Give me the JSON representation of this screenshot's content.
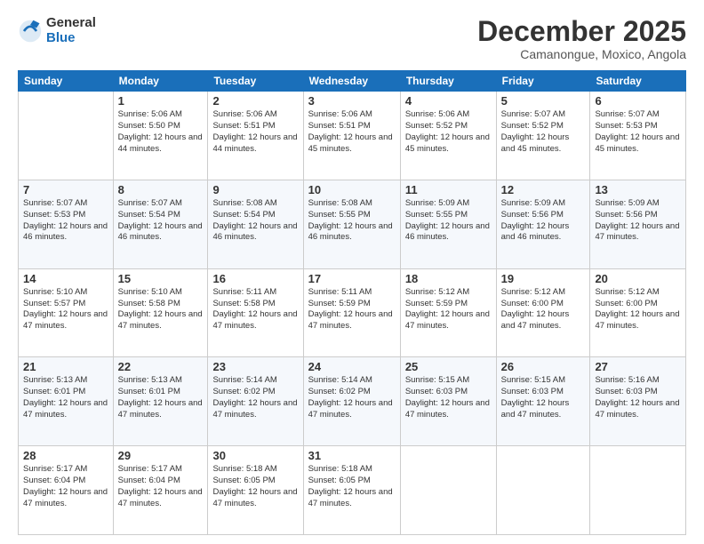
{
  "logo": {
    "general": "General",
    "blue": "Blue"
  },
  "title": {
    "month_year": "December 2025",
    "location": "Camanongue, Moxico, Angola"
  },
  "days_of_week": [
    "Sunday",
    "Monday",
    "Tuesday",
    "Wednesday",
    "Thursday",
    "Friday",
    "Saturday"
  ],
  "weeks": [
    [
      {
        "day": "",
        "info": ""
      },
      {
        "day": "1",
        "info": "Sunrise: 5:06 AM\nSunset: 5:50 PM\nDaylight: 12 hours\nand 44 minutes."
      },
      {
        "day": "2",
        "info": "Sunrise: 5:06 AM\nSunset: 5:51 PM\nDaylight: 12 hours\nand 44 minutes."
      },
      {
        "day": "3",
        "info": "Sunrise: 5:06 AM\nSunset: 5:51 PM\nDaylight: 12 hours\nand 45 minutes."
      },
      {
        "day": "4",
        "info": "Sunrise: 5:06 AM\nSunset: 5:52 PM\nDaylight: 12 hours\nand 45 minutes."
      },
      {
        "day": "5",
        "info": "Sunrise: 5:07 AM\nSunset: 5:52 PM\nDaylight: 12 hours\nand 45 minutes."
      },
      {
        "day": "6",
        "info": "Sunrise: 5:07 AM\nSunset: 5:53 PM\nDaylight: 12 hours\nand 45 minutes."
      }
    ],
    [
      {
        "day": "7",
        "info": "Sunrise: 5:07 AM\nSunset: 5:53 PM\nDaylight: 12 hours\nand 46 minutes."
      },
      {
        "day": "8",
        "info": "Sunrise: 5:07 AM\nSunset: 5:54 PM\nDaylight: 12 hours\nand 46 minutes."
      },
      {
        "day": "9",
        "info": "Sunrise: 5:08 AM\nSunset: 5:54 PM\nDaylight: 12 hours\nand 46 minutes."
      },
      {
        "day": "10",
        "info": "Sunrise: 5:08 AM\nSunset: 5:55 PM\nDaylight: 12 hours\nand 46 minutes."
      },
      {
        "day": "11",
        "info": "Sunrise: 5:09 AM\nSunset: 5:55 PM\nDaylight: 12 hours\nand 46 minutes."
      },
      {
        "day": "12",
        "info": "Sunrise: 5:09 AM\nSunset: 5:56 PM\nDaylight: 12 hours\nand 46 minutes."
      },
      {
        "day": "13",
        "info": "Sunrise: 5:09 AM\nSunset: 5:56 PM\nDaylight: 12 hours\nand 47 minutes."
      }
    ],
    [
      {
        "day": "14",
        "info": "Sunrise: 5:10 AM\nSunset: 5:57 PM\nDaylight: 12 hours\nand 47 minutes."
      },
      {
        "day": "15",
        "info": "Sunrise: 5:10 AM\nSunset: 5:58 PM\nDaylight: 12 hours\nand 47 minutes."
      },
      {
        "day": "16",
        "info": "Sunrise: 5:11 AM\nSunset: 5:58 PM\nDaylight: 12 hours\nand 47 minutes."
      },
      {
        "day": "17",
        "info": "Sunrise: 5:11 AM\nSunset: 5:59 PM\nDaylight: 12 hours\nand 47 minutes."
      },
      {
        "day": "18",
        "info": "Sunrise: 5:12 AM\nSunset: 5:59 PM\nDaylight: 12 hours\nand 47 minutes."
      },
      {
        "day": "19",
        "info": "Sunrise: 5:12 AM\nSunset: 6:00 PM\nDaylight: 12 hours\nand 47 minutes."
      },
      {
        "day": "20",
        "info": "Sunrise: 5:12 AM\nSunset: 6:00 PM\nDaylight: 12 hours\nand 47 minutes."
      }
    ],
    [
      {
        "day": "21",
        "info": "Sunrise: 5:13 AM\nSunset: 6:01 PM\nDaylight: 12 hours\nand 47 minutes."
      },
      {
        "day": "22",
        "info": "Sunrise: 5:13 AM\nSunset: 6:01 PM\nDaylight: 12 hours\nand 47 minutes."
      },
      {
        "day": "23",
        "info": "Sunrise: 5:14 AM\nSunset: 6:02 PM\nDaylight: 12 hours\nand 47 minutes."
      },
      {
        "day": "24",
        "info": "Sunrise: 5:14 AM\nSunset: 6:02 PM\nDaylight: 12 hours\nand 47 minutes."
      },
      {
        "day": "25",
        "info": "Sunrise: 5:15 AM\nSunset: 6:03 PM\nDaylight: 12 hours\nand 47 minutes."
      },
      {
        "day": "26",
        "info": "Sunrise: 5:15 AM\nSunset: 6:03 PM\nDaylight: 12 hours\nand 47 minutes."
      },
      {
        "day": "27",
        "info": "Sunrise: 5:16 AM\nSunset: 6:03 PM\nDaylight: 12 hours\nand 47 minutes."
      }
    ],
    [
      {
        "day": "28",
        "info": "Sunrise: 5:17 AM\nSunset: 6:04 PM\nDaylight: 12 hours\nand 47 minutes."
      },
      {
        "day": "29",
        "info": "Sunrise: 5:17 AM\nSunset: 6:04 PM\nDaylight: 12 hours\nand 47 minutes."
      },
      {
        "day": "30",
        "info": "Sunrise: 5:18 AM\nSunset: 6:05 PM\nDaylight: 12 hours\nand 47 minutes."
      },
      {
        "day": "31",
        "info": "Sunrise: 5:18 AM\nSunset: 6:05 PM\nDaylight: 12 hours\nand 47 minutes."
      },
      {
        "day": "",
        "info": ""
      },
      {
        "day": "",
        "info": ""
      },
      {
        "day": "",
        "info": ""
      }
    ]
  ]
}
